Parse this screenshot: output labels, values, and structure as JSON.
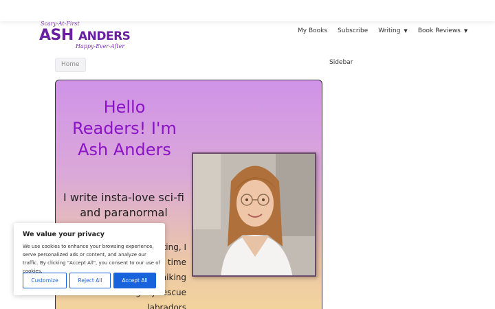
{
  "header": {
    "logo": {
      "tagline_top": "Scary-At-First",
      "name_first": "ASH",
      "name_second": "ANDERS",
      "tagline_bottom": "Happy-Ever-After"
    },
    "nav": [
      {
        "label": "My Books",
        "has_dropdown": false
      },
      {
        "label": "Subscribe",
        "has_dropdown": false
      },
      {
        "label": "Writing",
        "has_dropdown": true
      },
      {
        "label": "Book Reviews",
        "has_dropdown": true
      }
    ]
  },
  "breadcrumb": {
    "home_label": "Home"
  },
  "sidebar": {
    "title": "Sidebar"
  },
  "hero": {
    "headline": "Hello Readers! I'm Ash Anders",
    "subheadline": "I write insta-love sci-fi and paranormal",
    "body": "… When I'm not writing, I love to talk … spending time with … interests … and hiking … walking my rescue labradors"
  },
  "cookie_banner": {
    "title": "We value your privacy",
    "text": "We use cookies to enhance your browsing experience, serve personalized ads or content, and analyze our traffic. By clicking \"Accept All\", you consent to our use of cookies.",
    "customize_label": "Customize",
    "reject_label": "Reject All",
    "accept_label": "Accept All"
  },
  "colors": {
    "brand_purple": "#8b12c7",
    "logo_purple": "#6a1fa3",
    "consent_blue": "#1863dc"
  }
}
